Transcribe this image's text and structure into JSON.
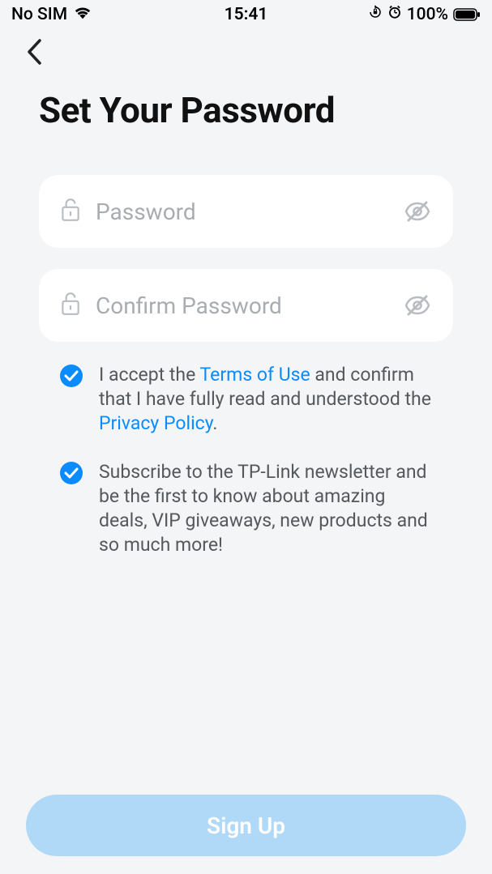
{
  "status": {
    "sim": "No SIM",
    "time": "15:41",
    "battery_percent": "100%"
  },
  "title": "Set Your Password",
  "fields": {
    "password": {
      "placeholder": "Password",
      "value": ""
    },
    "confirm": {
      "placeholder": "Confirm Password",
      "value": ""
    }
  },
  "consent": {
    "terms": {
      "checked": true,
      "prefix": "I accept the ",
      "terms_link": "Terms of Use",
      "mid": " and confirm that I have fully read and understood the ",
      "privacy_link": "Privacy Policy",
      "suffix": "."
    },
    "newsletter": {
      "checked": true,
      "text": "Subscribe to the TP-Link newsletter and be the first to know about amazing deals, VIP giveaways, new products and so much more!"
    }
  },
  "buttons": {
    "signup": "Sign Up"
  },
  "colors": {
    "accent": "#0a8bff",
    "signup_bg": "#b0d8f7"
  }
}
